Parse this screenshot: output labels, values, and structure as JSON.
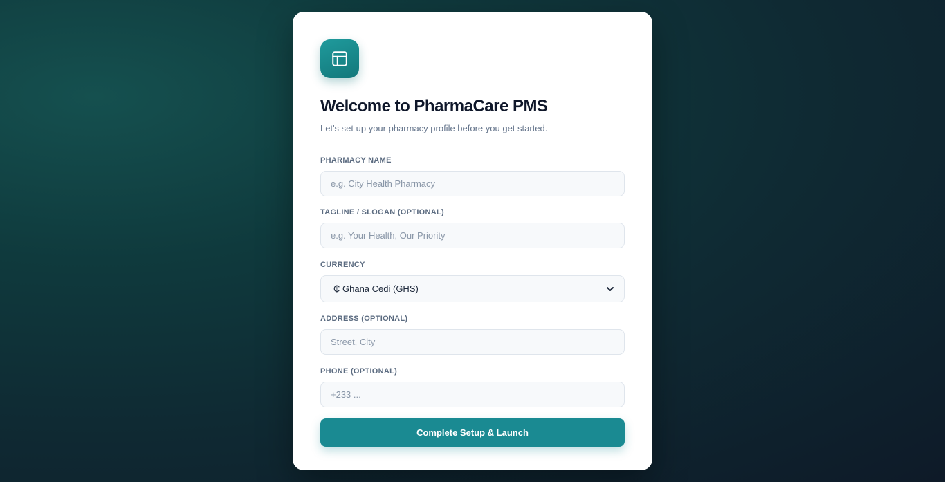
{
  "brand": {
    "accent": "#1a8a92",
    "icon": "layout-panel-icon"
  },
  "header": {
    "title": "Welcome to PharmaCare PMS",
    "subtitle": "Let's set up your pharmacy profile before you get started."
  },
  "form": {
    "pharmacy_name": {
      "label": "PHARMACY NAME",
      "placeholder": "e.g. City Health Pharmacy",
      "value": ""
    },
    "tagline": {
      "label": "TAGLINE / SLOGAN (OPTIONAL)",
      "placeholder": "e.g. Your Health, Our Priority",
      "value": ""
    },
    "currency": {
      "label": "CURRENCY",
      "selected": "₵ Ghana Cedi (GHS)",
      "icon": "chevron-down-icon"
    },
    "address": {
      "label": "ADDRESS (OPTIONAL)",
      "placeholder": "Street, City",
      "value": ""
    },
    "phone": {
      "label": "PHONE (OPTIONAL)",
      "placeholder": "+233 ...",
      "value": ""
    },
    "submit_label": "Complete Setup & Launch"
  }
}
